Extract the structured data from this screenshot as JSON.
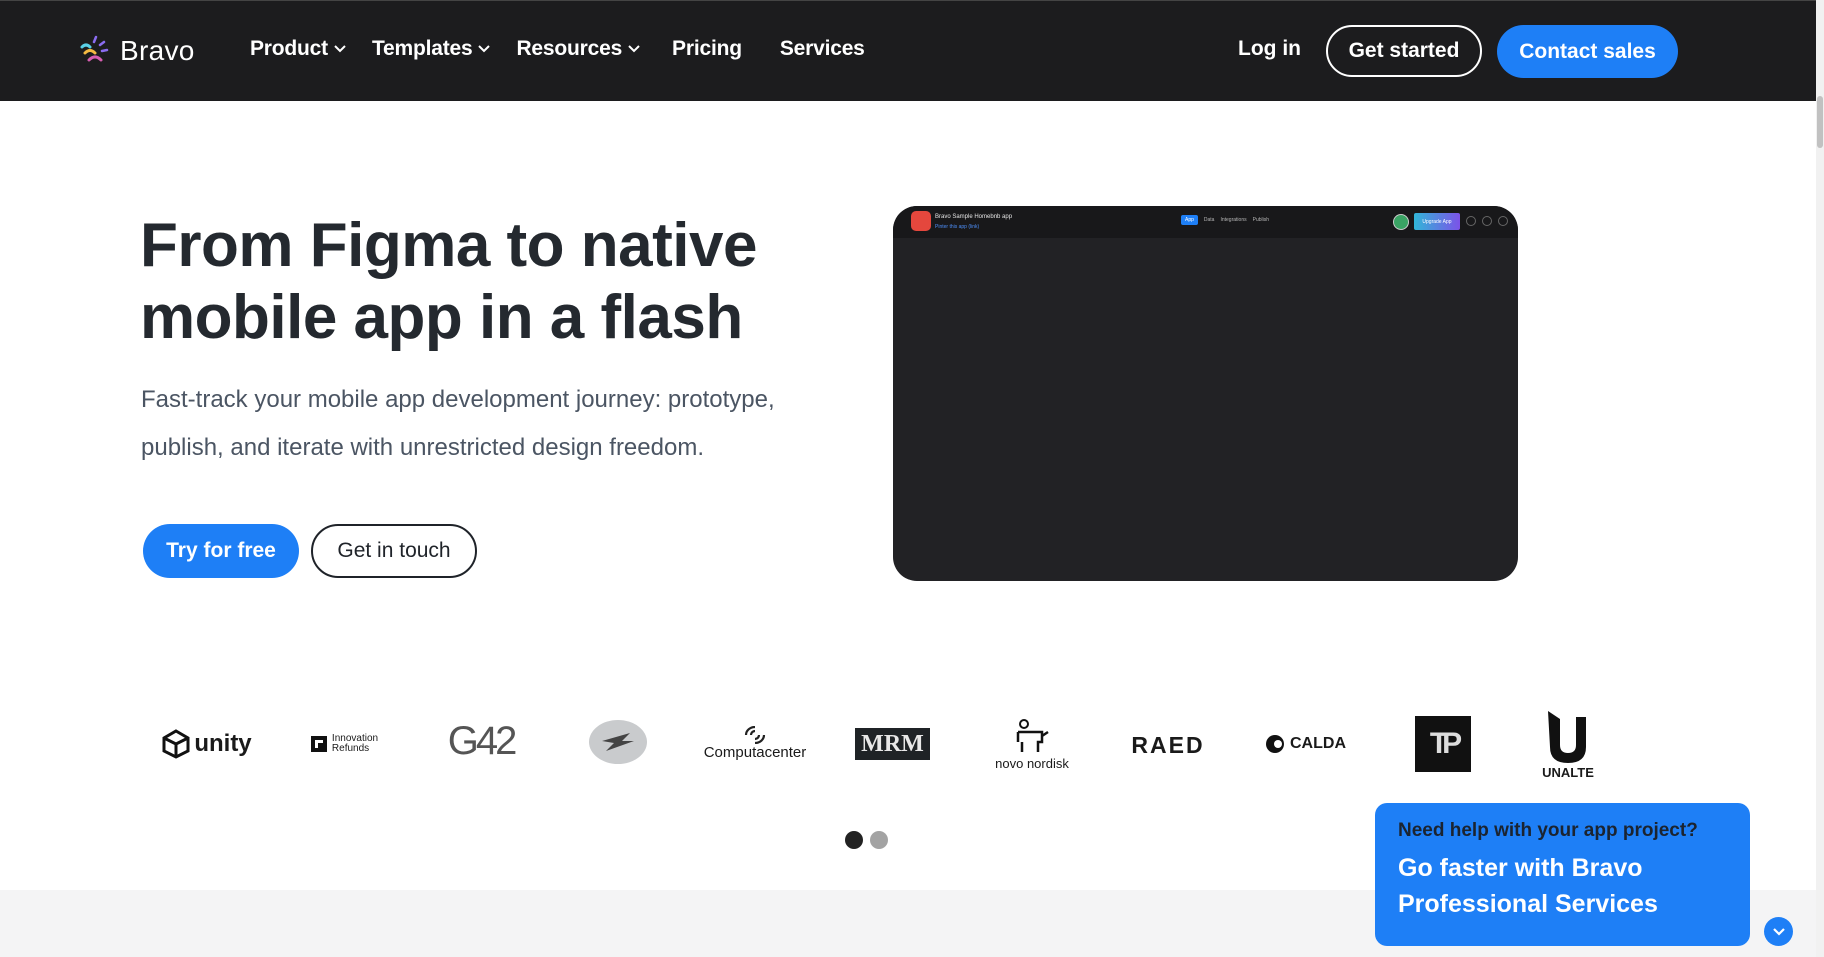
{
  "nav": {
    "brand": "Bravo",
    "menu": [
      {
        "label": "Product",
        "has_dropdown": true
      },
      {
        "label": "Templates",
        "has_dropdown": true
      },
      {
        "label": "Resources",
        "has_dropdown": true
      },
      {
        "label": "Pricing",
        "has_dropdown": false
      },
      {
        "label": "Services",
        "has_dropdown": false
      }
    ],
    "login_label": "Log in",
    "get_started_label": "Get started",
    "contact_sales_label": "Contact sales"
  },
  "hero": {
    "title_line1": "From Figma to native",
    "title_line2": "mobile app in a flash",
    "subtitle": "Fast-track your mobile app development journey: prototype, publish, and iterate with unrestricted design freedom.",
    "try_label": "Try for free",
    "touch_label": "Get in touch"
  },
  "preview": {
    "app_title": "Bravo Sample Homebnb app",
    "app_link": "Pinter this app (link)",
    "tabs": [
      "App",
      "Data",
      "Integrations",
      "Publish"
    ],
    "active_tab": "App",
    "upgrade_label": "Upgrade App"
  },
  "logos": {
    "items": [
      {
        "name": "unity",
        "text": "unity"
      },
      {
        "name": "innovation-refunds",
        "text_line1": "Innovation",
        "text_line2": "Refunds"
      },
      {
        "name": "g42",
        "text": "G42"
      },
      {
        "name": "la-poste",
        "text": ""
      },
      {
        "name": "computacenter",
        "text": "Computacenter"
      },
      {
        "name": "mrm",
        "text": "MRM"
      },
      {
        "name": "novo-nordisk",
        "text": "novo nordisk"
      },
      {
        "name": "raed",
        "text": "RAED"
      },
      {
        "name": "calda",
        "text": "CALDA"
      },
      {
        "name": "tp",
        "text": "TP"
      },
      {
        "name": "unalte",
        "text": "UNALTE"
      }
    ],
    "pager": {
      "pages": 2,
      "active": 1
    }
  },
  "help_widget": {
    "question": "Need help with your app project?",
    "cta_line1": "Go faster with Bravo",
    "cta_line2": "Professional Services"
  },
  "colors": {
    "accent": "#1e7ff6",
    "nav_bg": "#1c1c1e",
    "heading": "#24292f"
  }
}
